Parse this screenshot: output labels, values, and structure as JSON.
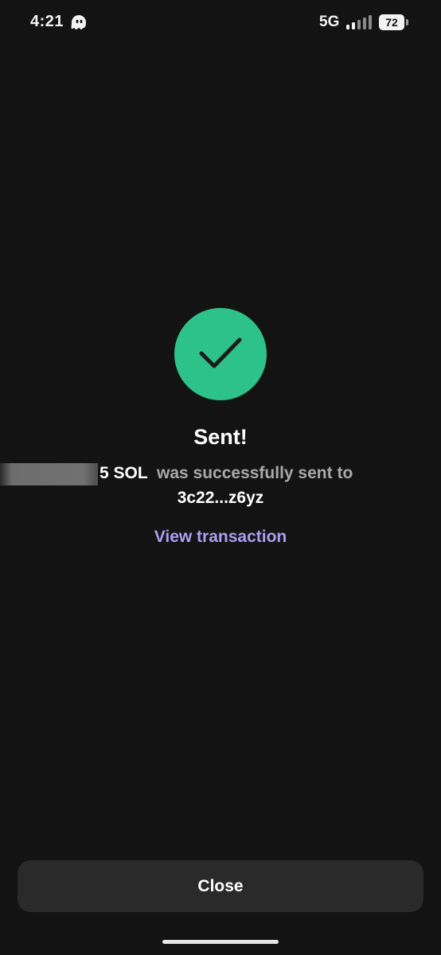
{
  "status_bar": {
    "time": "4:21",
    "network": "5G",
    "battery": "72",
    "app_icon": "ghost-icon",
    "signal_icon": "signal-bars-icon"
  },
  "success": {
    "icon": "checkmark-icon",
    "badge_color": "#2ec28b",
    "title": "Sent!",
    "amount": "5 SOL",
    "message": "was successfully sent to",
    "recipient": "3c22...z6yz",
    "view_transaction_label": "View transaction",
    "link_color": "#ab9ff2"
  },
  "footer": {
    "close_label": "Close"
  }
}
